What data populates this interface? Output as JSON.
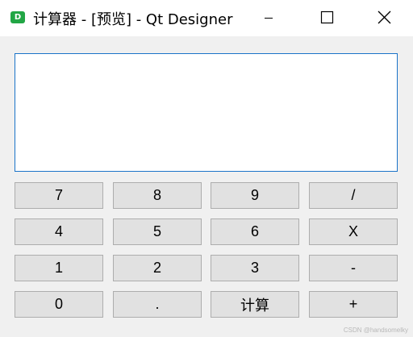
{
  "window": {
    "app_icon_text": "D",
    "title": "计算器 - [预览] - Qt Designer",
    "controls": [
      "minimize-icon",
      "maximize-icon",
      "close-icon"
    ]
  },
  "display": {
    "value": ""
  },
  "keypad": {
    "row1": [
      "7",
      "8",
      "9",
      "/"
    ],
    "row2": [
      "4",
      "5",
      "6",
      "X"
    ],
    "row3": [
      "1",
      "2",
      "3",
      "-"
    ],
    "row4": [
      "0",
      ".",
      "计算",
      "+"
    ]
  },
  "watermark": "CSDN @handsomelky",
  "colors": {
    "accent": "#1a73c8",
    "app_icon": "#22a645",
    "button_face": "#e1e1e1"
  }
}
